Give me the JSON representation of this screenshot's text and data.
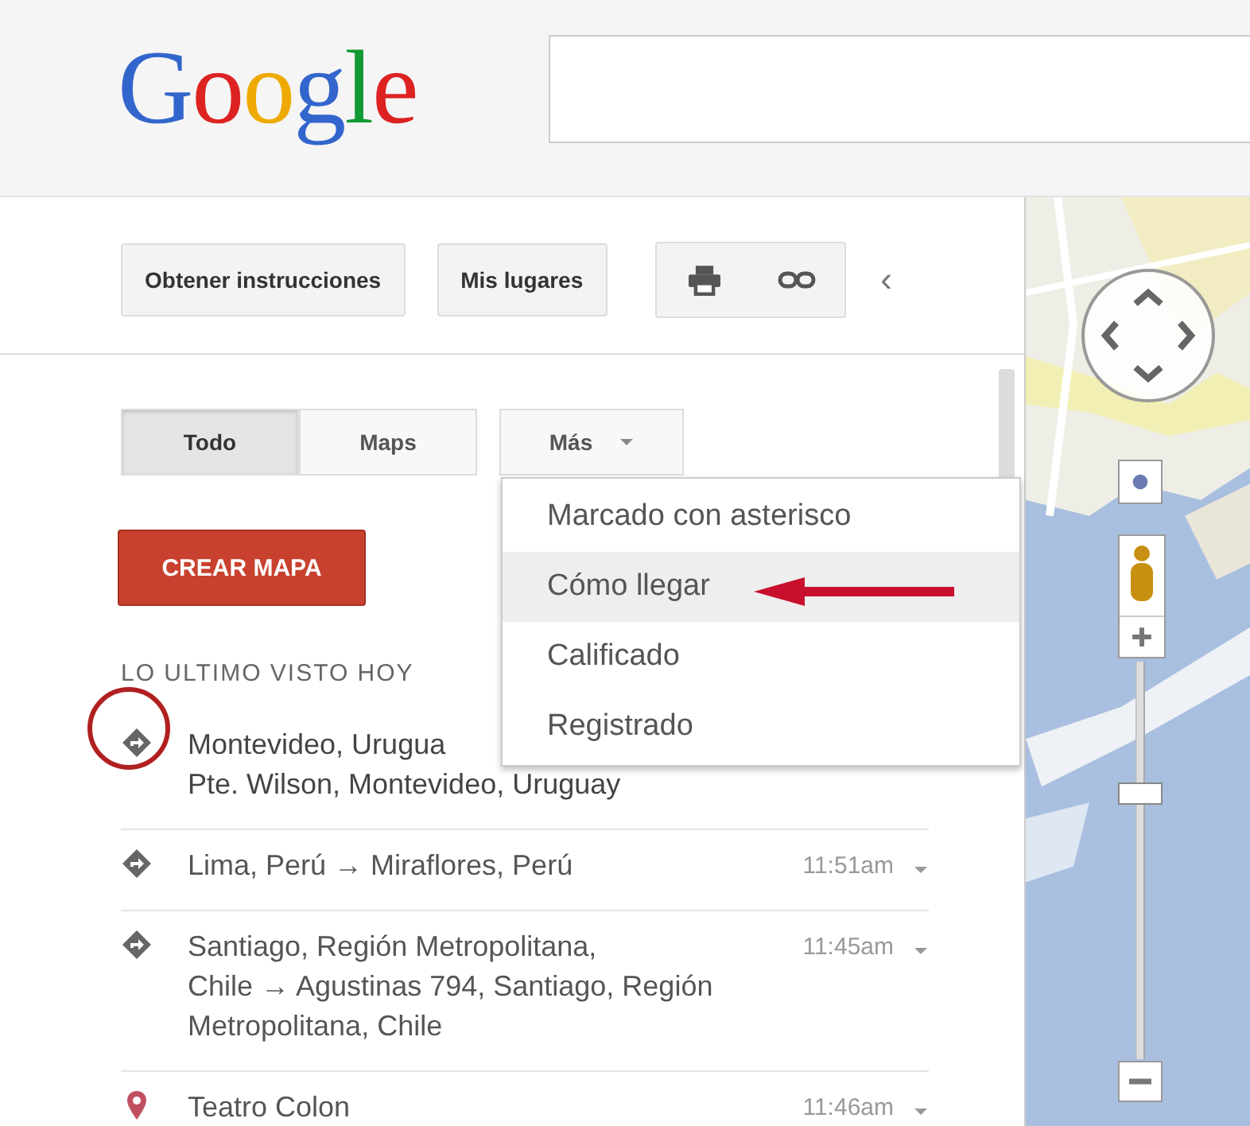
{
  "header": {
    "logo": "Google"
  },
  "toolbar": {
    "buttons": [
      {
        "label": "Obtener instrucciones"
      },
      {
        "label": "Mis lugares"
      }
    ],
    "collapse": "‹"
  },
  "tabs": [
    {
      "label": "Todo",
      "selected": true
    },
    {
      "label": "Maps",
      "selected": false
    },
    {
      "label": "Más",
      "selected": false,
      "dropdown": true
    }
  ],
  "menu": {
    "items": [
      {
        "label": "Marcado con asterisco",
        "selected": false
      },
      {
        "label": "Cómo llegar",
        "selected": true
      },
      {
        "label": "Calificado",
        "selected": false
      },
      {
        "label": "Registrado",
        "selected": false
      }
    ]
  },
  "zoom": {
    "level": 0.68
  },
  "create_button": "CREAR MAPA",
  "section_heading": "LO ULTIMO VISTO HOY",
  "recent": [
    {
      "kind": "directions",
      "lines": [
        "Montevideo, Urugua",
        "Pte. Wilson, Montevideo, Uruguay"
      ],
      "highlighted": true
    },
    {
      "kind": "directions",
      "lines": [
        "Lima, Perú → Miraflores, Perú"
      ],
      "time": "11:51am"
    },
    {
      "kind": "directions",
      "lines": [
        "Santiago, Región Metropolitana,",
        "Chile → Agustinas 794, Santiago, Región",
        "Metropolitana, Chile"
      ],
      "time": "11:45am"
    },
    {
      "kind": "place",
      "lines": [
        "Teatro Colon"
      ],
      "time": "11:46am"
    }
  ]
}
